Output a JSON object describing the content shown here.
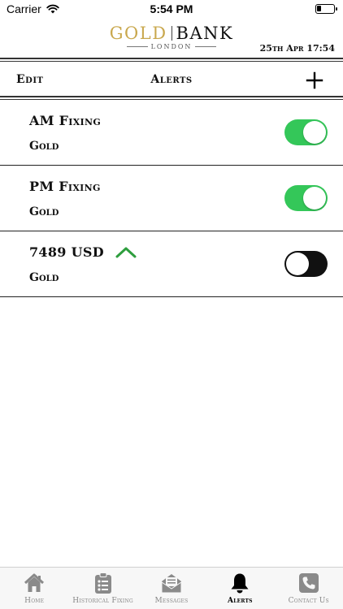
{
  "status_bar": {
    "carrier": "Carrier",
    "time": "5:54 PM"
  },
  "brand": {
    "gold": "GOLD",
    "bank": "BANK",
    "sub": "LONDON"
  },
  "header": {
    "datetime": "25th Apr 17:54"
  },
  "toolbar": {
    "edit_label": "Edit",
    "title": "Alerts"
  },
  "alerts": [
    {
      "title": "AM Fixing",
      "metal": "Gold",
      "enabled": true,
      "direction": null
    },
    {
      "title": "PM Fixing",
      "metal": "Gold",
      "enabled": true,
      "direction": null
    },
    {
      "title": "7489 USD",
      "metal": "Gold",
      "enabled": false,
      "direction": "up"
    }
  ],
  "tabs": [
    {
      "label": "Home",
      "icon": "house-icon",
      "active": false
    },
    {
      "label": "Historical Fixing",
      "icon": "clipboard-list-icon",
      "active": false
    },
    {
      "label": "Messages",
      "icon": "envelope-open-icon",
      "active": false
    },
    {
      "label": "Alerts",
      "icon": "bell-icon",
      "active": true
    },
    {
      "label": "Contact Us",
      "icon": "phone-icon",
      "active": false
    }
  ],
  "colors": {
    "brand_gold": "#c9a84e",
    "toggle_on": "#34c759",
    "toggle_off": "#111111",
    "arrow_up": "#2e9e3e"
  }
}
